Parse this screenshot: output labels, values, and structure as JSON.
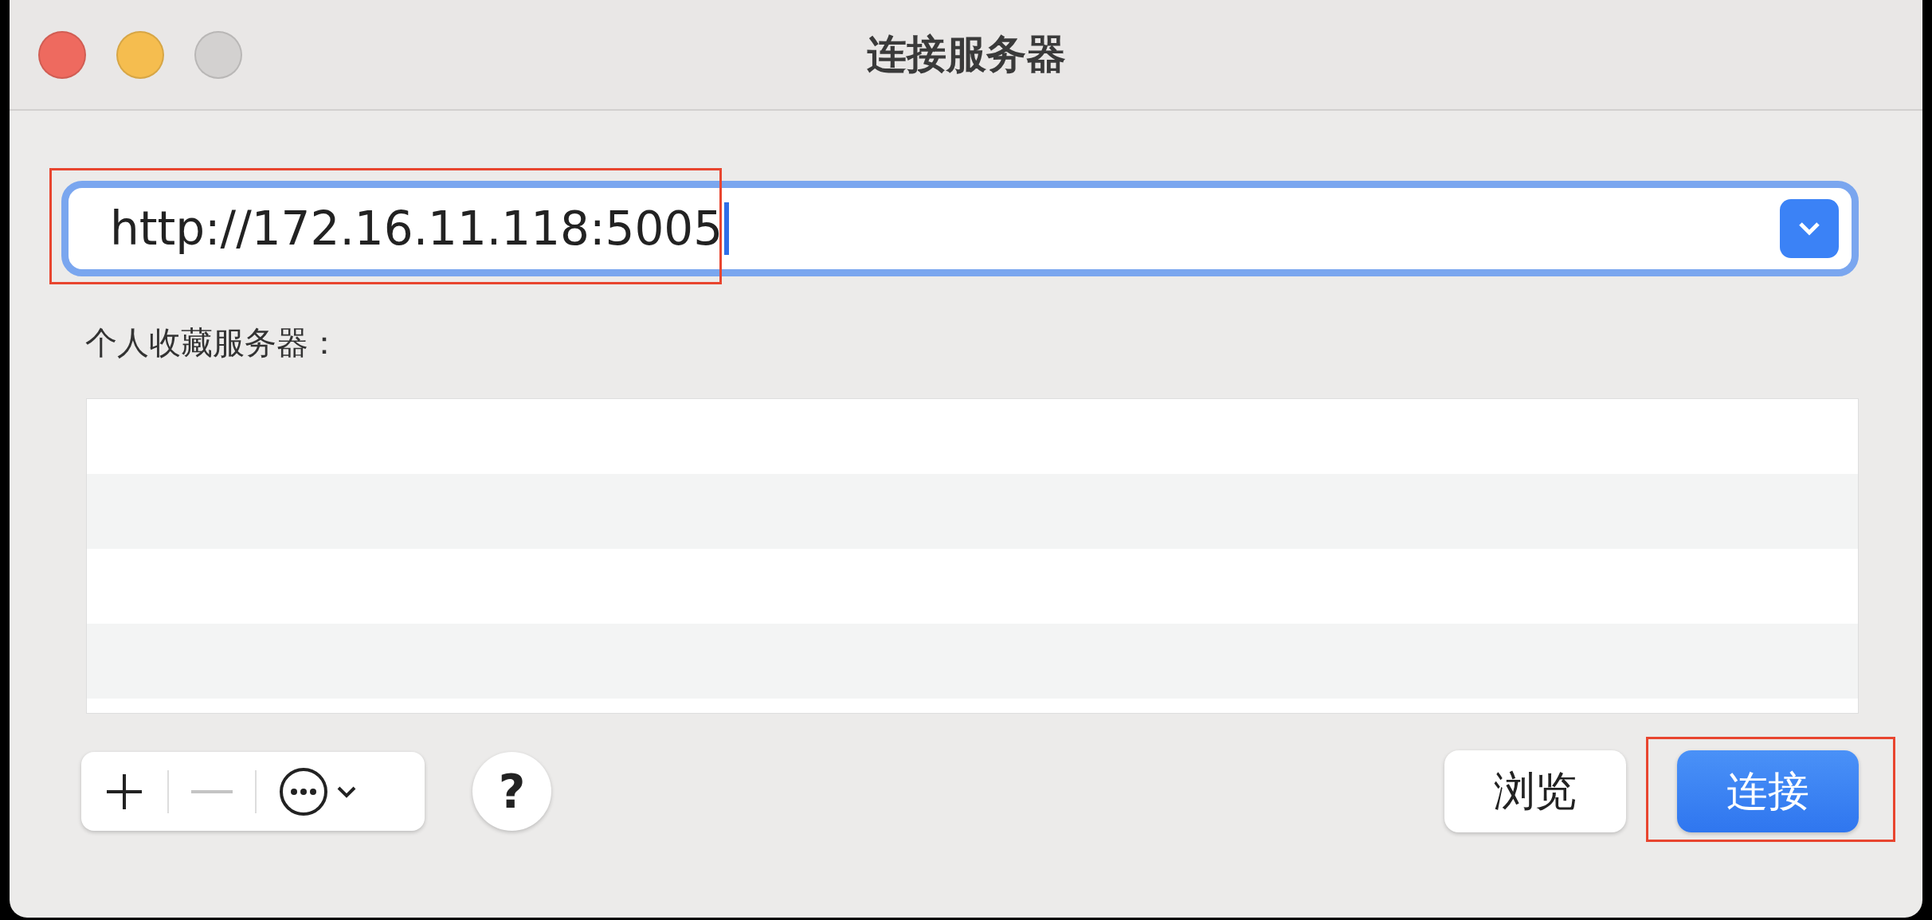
{
  "window": {
    "title": "连接服务器",
    "controls": [
      {
        "kind": "close"
      },
      {
        "kind": "minimize"
      },
      {
        "kind": "zoom"
      }
    ]
  },
  "address": {
    "value": "http://172.16.11.118:5005",
    "focused": true,
    "highlighted": true
  },
  "favorites_label": "个人收藏服务器：",
  "toolbar": [
    {
      "kind": "add",
      "disabled": false
    },
    {
      "kind": "remove",
      "disabled": true
    },
    {
      "kind": "more",
      "disabled": false
    }
  ],
  "help": "?",
  "buttons": [
    {
      "label": "浏览",
      "kind": "secondary",
      "highlighted": false
    },
    {
      "label": "连接",
      "kind": "primary",
      "highlighted": true
    }
  ]
}
